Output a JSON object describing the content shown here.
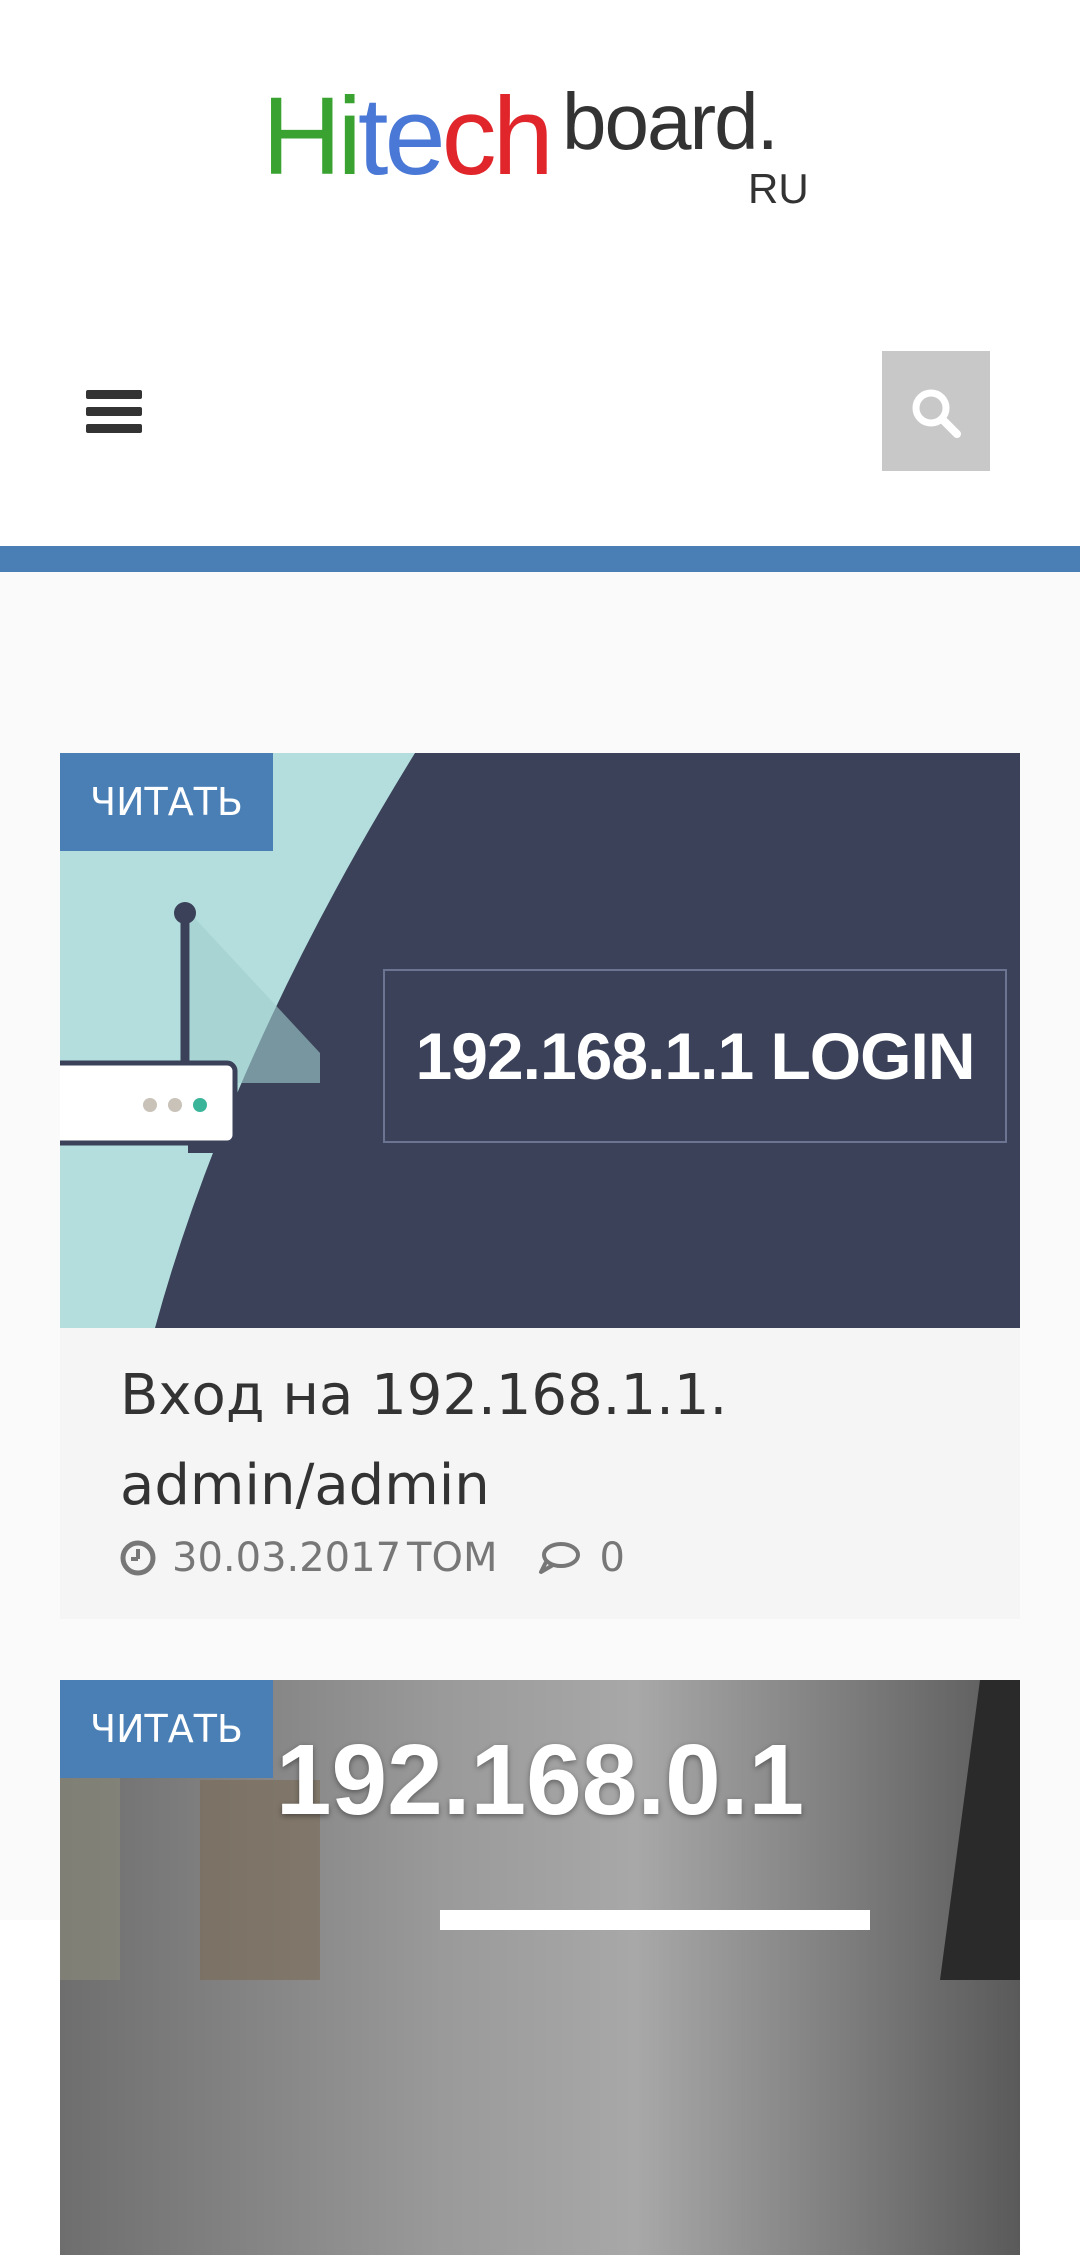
{
  "header": {
    "logo": {
      "hitech": [
        "Hi",
        "te",
        "ch"
      ],
      "board": "board.",
      "ru": "RU"
    },
    "menu_icon": "hamburger-menu-icon",
    "search_icon": "search-icon"
  },
  "colors": {
    "accent": "#4a7fb5",
    "logo_green": "#3aa230",
    "logo_blue": "#4a78d6",
    "logo_red": "#e0262b"
  },
  "posts": [
    {
      "badge": "ЧИТАТЬ",
      "image_text": "192.168.1.1 LOGIN",
      "title": "Вход на 192.168.1.1. admin/admin",
      "date": "30.03.2017",
      "author": "TOM",
      "comments": "0"
    },
    {
      "badge": "ЧИТАТЬ",
      "image_text": "192.168.0.1"
    }
  ]
}
